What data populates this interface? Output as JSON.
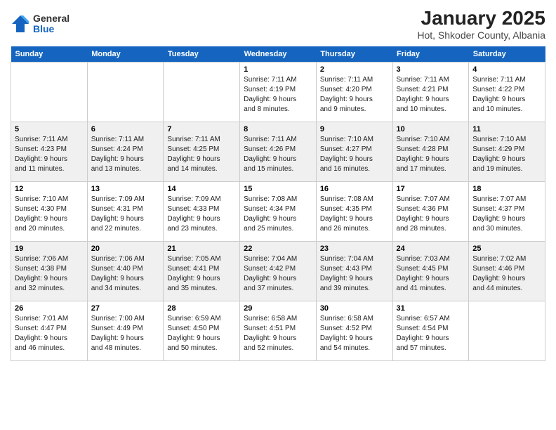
{
  "logo": {
    "general": "General",
    "blue": "Blue"
  },
  "title": "January 2025",
  "location": "Hot, Shkoder County, Albania",
  "weekdays": [
    "Sunday",
    "Monday",
    "Tuesday",
    "Wednesday",
    "Thursday",
    "Friday",
    "Saturday"
  ],
  "weeks": [
    [
      {
        "day": "",
        "content": ""
      },
      {
        "day": "",
        "content": ""
      },
      {
        "day": "",
        "content": ""
      },
      {
        "day": "1",
        "content": "Sunrise: 7:11 AM\nSunset: 4:19 PM\nDaylight: 9 hours\nand 8 minutes."
      },
      {
        "day": "2",
        "content": "Sunrise: 7:11 AM\nSunset: 4:20 PM\nDaylight: 9 hours\nand 9 minutes."
      },
      {
        "day": "3",
        "content": "Sunrise: 7:11 AM\nSunset: 4:21 PM\nDaylight: 9 hours\nand 10 minutes."
      },
      {
        "day": "4",
        "content": "Sunrise: 7:11 AM\nSunset: 4:22 PM\nDaylight: 9 hours\nand 10 minutes."
      }
    ],
    [
      {
        "day": "5",
        "content": "Sunrise: 7:11 AM\nSunset: 4:23 PM\nDaylight: 9 hours\nand 11 minutes."
      },
      {
        "day": "6",
        "content": "Sunrise: 7:11 AM\nSunset: 4:24 PM\nDaylight: 9 hours\nand 13 minutes."
      },
      {
        "day": "7",
        "content": "Sunrise: 7:11 AM\nSunset: 4:25 PM\nDaylight: 9 hours\nand 14 minutes."
      },
      {
        "day": "8",
        "content": "Sunrise: 7:11 AM\nSunset: 4:26 PM\nDaylight: 9 hours\nand 15 minutes."
      },
      {
        "day": "9",
        "content": "Sunrise: 7:10 AM\nSunset: 4:27 PM\nDaylight: 9 hours\nand 16 minutes."
      },
      {
        "day": "10",
        "content": "Sunrise: 7:10 AM\nSunset: 4:28 PM\nDaylight: 9 hours\nand 17 minutes."
      },
      {
        "day": "11",
        "content": "Sunrise: 7:10 AM\nSunset: 4:29 PM\nDaylight: 9 hours\nand 19 minutes."
      }
    ],
    [
      {
        "day": "12",
        "content": "Sunrise: 7:10 AM\nSunset: 4:30 PM\nDaylight: 9 hours\nand 20 minutes."
      },
      {
        "day": "13",
        "content": "Sunrise: 7:09 AM\nSunset: 4:31 PM\nDaylight: 9 hours\nand 22 minutes."
      },
      {
        "day": "14",
        "content": "Sunrise: 7:09 AM\nSunset: 4:33 PM\nDaylight: 9 hours\nand 23 minutes."
      },
      {
        "day": "15",
        "content": "Sunrise: 7:08 AM\nSunset: 4:34 PM\nDaylight: 9 hours\nand 25 minutes."
      },
      {
        "day": "16",
        "content": "Sunrise: 7:08 AM\nSunset: 4:35 PM\nDaylight: 9 hours\nand 26 minutes."
      },
      {
        "day": "17",
        "content": "Sunrise: 7:07 AM\nSunset: 4:36 PM\nDaylight: 9 hours\nand 28 minutes."
      },
      {
        "day": "18",
        "content": "Sunrise: 7:07 AM\nSunset: 4:37 PM\nDaylight: 9 hours\nand 30 minutes."
      }
    ],
    [
      {
        "day": "19",
        "content": "Sunrise: 7:06 AM\nSunset: 4:38 PM\nDaylight: 9 hours\nand 32 minutes."
      },
      {
        "day": "20",
        "content": "Sunrise: 7:06 AM\nSunset: 4:40 PM\nDaylight: 9 hours\nand 34 minutes."
      },
      {
        "day": "21",
        "content": "Sunrise: 7:05 AM\nSunset: 4:41 PM\nDaylight: 9 hours\nand 35 minutes."
      },
      {
        "day": "22",
        "content": "Sunrise: 7:04 AM\nSunset: 4:42 PM\nDaylight: 9 hours\nand 37 minutes."
      },
      {
        "day": "23",
        "content": "Sunrise: 7:04 AM\nSunset: 4:43 PM\nDaylight: 9 hours\nand 39 minutes."
      },
      {
        "day": "24",
        "content": "Sunrise: 7:03 AM\nSunset: 4:45 PM\nDaylight: 9 hours\nand 41 minutes."
      },
      {
        "day": "25",
        "content": "Sunrise: 7:02 AM\nSunset: 4:46 PM\nDaylight: 9 hours\nand 44 minutes."
      }
    ],
    [
      {
        "day": "26",
        "content": "Sunrise: 7:01 AM\nSunset: 4:47 PM\nDaylight: 9 hours\nand 46 minutes."
      },
      {
        "day": "27",
        "content": "Sunrise: 7:00 AM\nSunset: 4:49 PM\nDaylight: 9 hours\nand 48 minutes."
      },
      {
        "day": "28",
        "content": "Sunrise: 6:59 AM\nSunset: 4:50 PM\nDaylight: 9 hours\nand 50 minutes."
      },
      {
        "day": "29",
        "content": "Sunrise: 6:58 AM\nSunset: 4:51 PM\nDaylight: 9 hours\nand 52 minutes."
      },
      {
        "day": "30",
        "content": "Sunrise: 6:58 AM\nSunset: 4:52 PM\nDaylight: 9 hours\nand 54 minutes."
      },
      {
        "day": "31",
        "content": "Sunrise: 6:57 AM\nSunset: 4:54 PM\nDaylight: 9 hours\nand 57 minutes."
      },
      {
        "day": "",
        "content": ""
      }
    ]
  ]
}
